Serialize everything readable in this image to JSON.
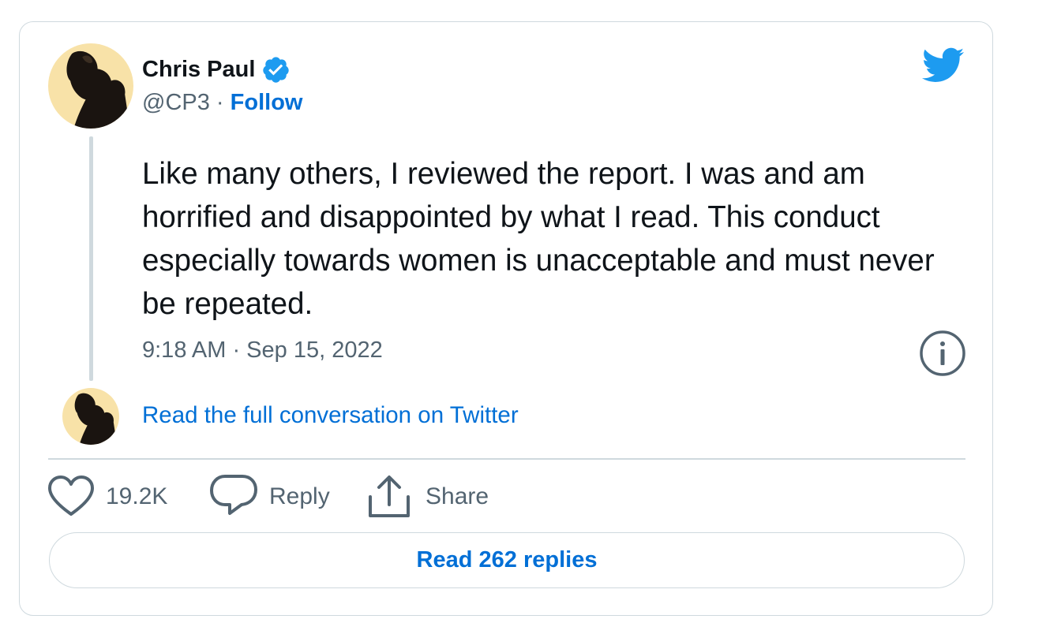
{
  "author": {
    "name": "Chris Paul",
    "handle": "@CP3",
    "separator": "·",
    "follow_label": "Follow"
  },
  "tweet": {
    "text": "Like many others, I reviewed the report. I was and am horrified and disappointed by what I read. This conduct especially towards women is unacceptable and must never be repeated.",
    "timestamp": "9:18 AM · Sep 15, 2022"
  },
  "conversation_link": "Read the full conversation on Twitter",
  "actions": {
    "like_count": "19.2K",
    "reply_label": "Reply",
    "share_label": "Share"
  },
  "read_replies_label": "Read 262 replies",
  "icons": {
    "verified": "verified-badge-icon",
    "brand": "twitter-bird-icon",
    "info": "info-icon",
    "like": "heart-icon",
    "reply": "speech-bubble-icon",
    "share": "share-upload-icon"
  },
  "colors": {
    "link_blue": "#006fd6",
    "twitter_blue": "#1d9bf0",
    "text": "#0f1419",
    "muted": "#536471",
    "border": "#cfd9de",
    "avatar_bg": "#f8e2a8"
  }
}
